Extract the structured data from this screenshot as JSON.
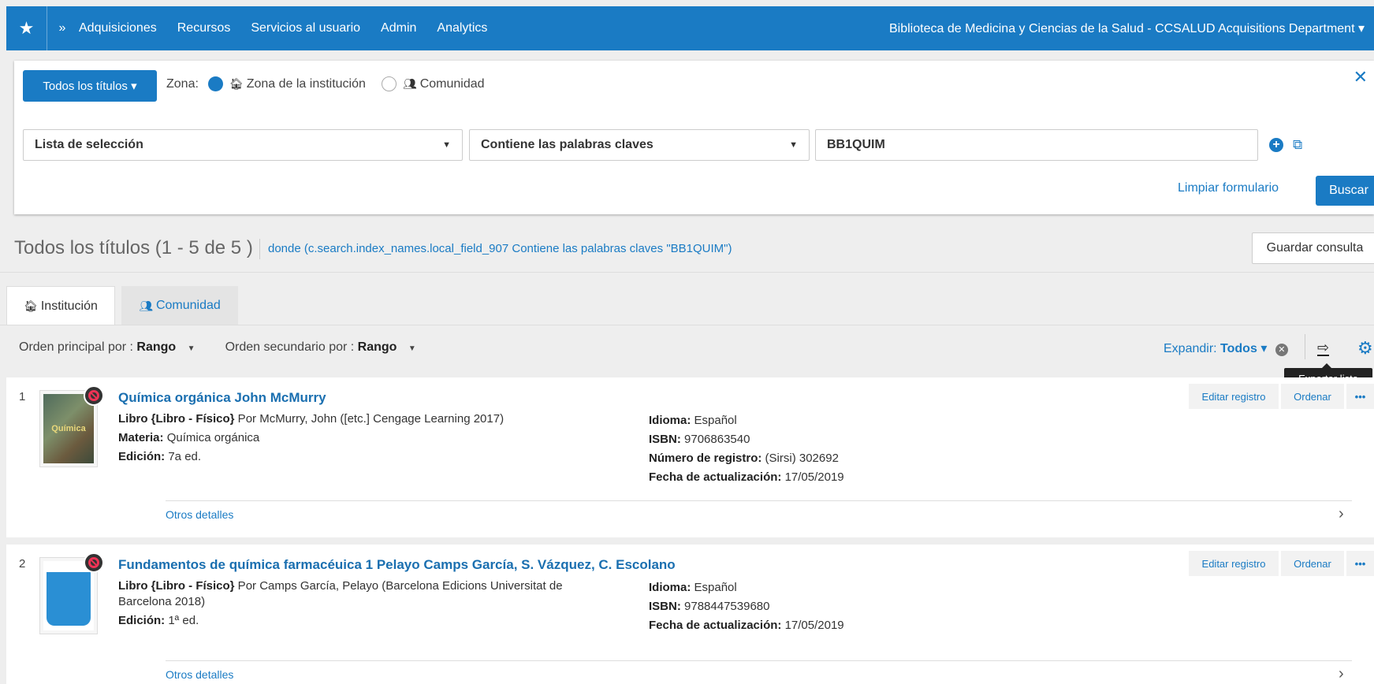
{
  "topbar": {
    "nav": [
      "Adquisiciones",
      "Recursos",
      "Servicios al usuario",
      "Admin",
      "Analytics"
    ],
    "institution": "Biblioteca de Medicina y Ciencias de la Salud - CCSALUD Acquisitions Department"
  },
  "search": {
    "scope_button": "Todos los títulos",
    "zone_label": "Zona:",
    "zone_institution": "Zona de la institución",
    "zone_community": "Comunidad",
    "field_select": "Lista de selección",
    "operator_select": "Contiene las palabras claves",
    "value": "BB1QUIM",
    "clear_label": "Limpiar formulario",
    "search_label": "Buscar"
  },
  "results": {
    "title": "Todos los títulos (1 - 5 de 5 )",
    "query": "donde (c.search.index_names.local_field_907 Contiene las palabras claves \"BB1QUIM\")",
    "save_label": "Guardar consulta"
  },
  "tabs": [
    {
      "label": "Institución"
    },
    {
      "label": "Comunidad"
    }
  ],
  "sort": {
    "primary_label": "Orden principal por :",
    "primary_value": "Rango",
    "secondary_label": "Orden secundario por :",
    "secondary_value": "Rango",
    "expand_label": "Expandir:",
    "expand_value": "Todos",
    "export_tooltip": "Exportar lista"
  },
  "records": [
    {
      "num": "1",
      "cover_text": "Química",
      "title": "Química orgánica John McMurry",
      "type_label": "Libro {Libro - Físico}",
      "type_rest": " Por McMurry, John ([etc.] Cengage Learning 2017)",
      "subject_label": "Materia:",
      "subject": "Química orgánica",
      "edition_label": "Edición:",
      "edition": "7a ed.",
      "language_label": "Idioma:",
      "language": "Español",
      "isbn_label": "ISBN:",
      "isbn": "9706863540",
      "record_label": "Número de registro:",
      "record": "(Sirsi) 302692",
      "updated_label": "Fecha de actualización:",
      "updated": "17/05/2019",
      "edit_label": "Editar registro",
      "order_label": "Ordenar",
      "more_label": "•••",
      "details_label": "Otros detalles"
    },
    {
      "num": "2",
      "title": "Fundamentos de química farmacéuica 1 Pelayo Camps García, S. Vázquez, C. Escolano",
      "type_label": "Libro {Libro - Físico}",
      "type_rest": " Por Camps García, Pelayo (Barcelona Edicions Universitat de Barcelona 2018)",
      "edition_label": "Edición:",
      "edition": "1ª ed.",
      "language_label": "Idioma:",
      "language": "Español",
      "isbn_label": "ISBN:",
      "isbn": "9788447539680",
      "updated_label": "Fecha de actualización:",
      "updated": "17/05/2019",
      "edit_label": "Editar registro",
      "order_label": "Ordenar",
      "more_label": "•••",
      "details_label": "Otros detalles"
    }
  ]
}
